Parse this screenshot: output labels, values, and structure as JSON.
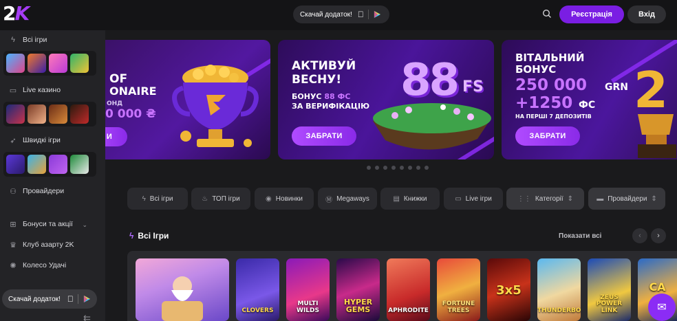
{
  "header": {
    "logo_main": "2",
    "logo_accent": "K",
    "download_label": "Скачай додаток!",
    "register_label": "Реєстрація",
    "login_label": "Вхід"
  },
  "sidebar": {
    "all_games": "Всі ігри",
    "live_casino": "Live казино",
    "fast_games": "Швидкі ігри",
    "providers": "Провайдери",
    "bonuses": "Бонуси та акції",
    "club": "Клуб азарту 2K",
    "wheel": "Колесо Удачі",
    "download_label": "Скачай додаток!"
  },
  "banners": {
    "b1": {
      "line1": "OF",
      "line2": "ONAIRE",
      "line3": "ОНД",
      "amount": "0 000 ₴",
      "button": "И"
    },
    "b2": {
      "line1": "АКТИВУЙ",
      "line2": "ВЕСНУ!",
      "bonus_prefix": "БОНУС",
      "bonus_value": "88 ФС",
      "bonus_suffix": "ЗА ВЕРИФІКАЦІЮ",
      "badge": "88",
      "badge_suffix": "FS",
      "button": "ЗАБРАТИ"
    },
    "b3": {
      "line1": "ВІТАЛЬНИЙ",
      "line2": "БОНУС",
      "amount": "250 000",
      "currency": "GRN",
      "fs": "+1250",
      "fs_suffix": "ФС",
      "note": "НА ПЕРШІ 7 ДЕПОЗИТІВ",
      "button": "ЗАБРАТИ"
    }
  },
  "filters": [
    "Всі ігри",
    "ТОП ігри",
    "Новинки",
    "Megaways",
    "Книжки",
    "Live ігри",
    "Категорії",
    "Провайдери"
  ],
  "section": {
    "title": "Всі Ігри",
    "show_all": "Показати всі"
  },
  "games": [
    {
      "label": ""
    },
    {
      "label": "CLOVERS"
    },
    {
      "label": "MULTI WILDS"
    },
    {
      "label": "HYPER GEMS"
    },
    {
      "label": "APHRODITE"
    },
    {
      "label": "FORTUNE TREES"
    },
    {
      "label": "3x5"
    },
    {
      "label": "THUNDERBOLTS"
    },
    {
      "label": "ZEUS POWER LINK"
    },
    {
      "label": "CA"
    }
  ],
  "colors": {
    "accent": "#7a1ee3",
    "background": "#1a1a1c",
    "sidebar": "#232326"
  }
}
